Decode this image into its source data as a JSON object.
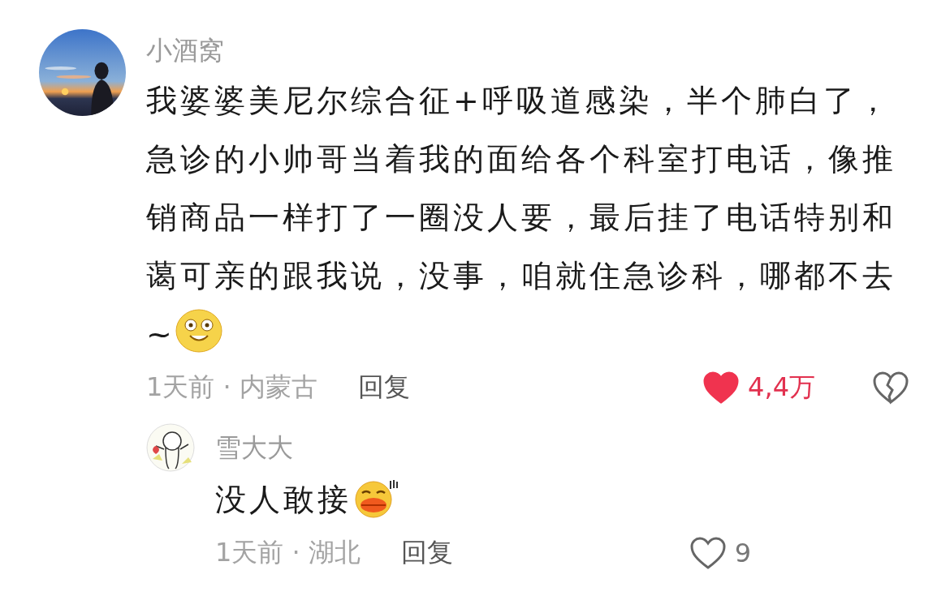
{
  "comments": [
    {
      "username": "小酒窝",
      "text": "我婆婆美尼尔综合征+呼吸道感染，半个肺白了，急诊的小帅哥当着我的面给各个科室打电话，像推销商品一样打了一圈没人要，最后挂了电话特别和蔼可亲的跟我说，没事，咱就住急诊科，哪都不去~",
      "emoji": {
        "kind": "grin"
      },
      "meta": "1天前 · 内蒙古",
      "reply": "回复",
      "likes": "4,4万",
      "liked": true,
      "children": [
        {
          "avatar": {
            "kind": "cartoon"
          },
          "username": "雪大大",
          "text": "没人敢接",
          "emoji": {
            "kind": "pout"
          },
          "meta": "1天前 · 湖北",
          "reply": "回复",
          "likes": "9",
          "liked": false
        }
      ]
    }
  ]
}
